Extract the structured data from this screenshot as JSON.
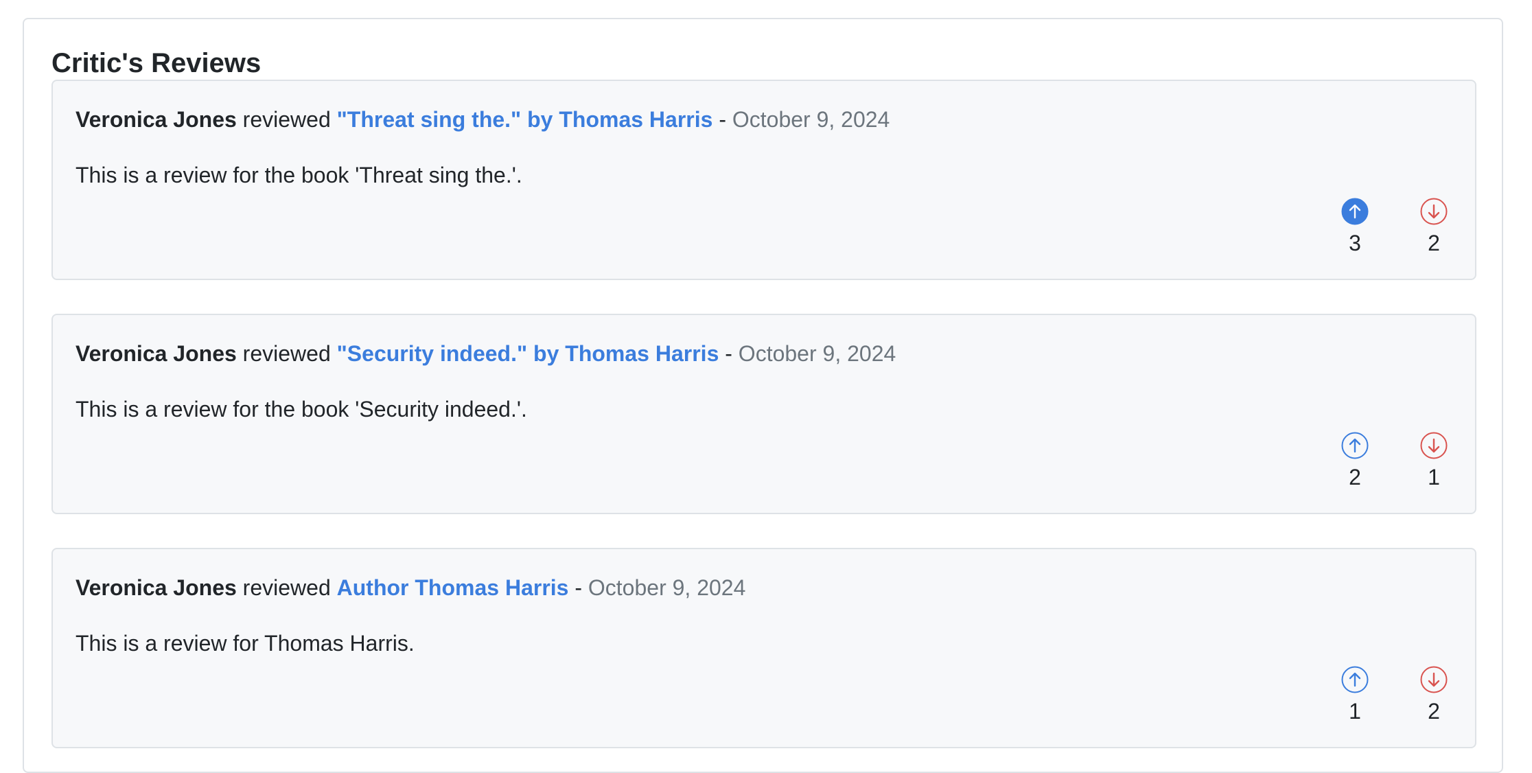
{
  "panel": {
    "title": "Critic's Reviews"
  },
  "reviews": [
    {
      "reviewer": "Veronica Jones",
      "verb": "reviewed",
      "target": "\"Threat sing the.\" by Thomas Harris",
      "separator": "-",
      "date": "October 9, 2024",
      "body": "This is a review for the book 'Threat sing the.'.",
      "upvotes": "3",
      "downvotes": "2",
      "upvote_active": true
    },
    {
      "reviewer": "Veronica Jones",
      "verb": "reviewed",
      "target": "\"Security indeed.\" by Thomas Harris",
      "separator": "-",
      "date": "October 9, 2024",
      "body": "This is a review for the book 'Security indeed.'.",
      "upvotes": "2",
      "downvotes": "1",
      "upvote_active": false
    },
    {
      "reviewer": "Veronica Jones",
      "verb": "reviewed",
      "target": "Author Thomas Harris",
      "separator": "-",
      "date": "October 9, 2024",
      "body": "This is a review for Thomas Harris.",
      "upvotes": "1",
      "downvotes": "2",
      "upvote_active": false
    }
  ],
  "icons": {
    "upvote": "arrow-up-circle-icon",
    "downvote": "arrow-down-circle-icon"
  },
  "colors": {
    "link": "#3b7ddd",
    "upvote": "#3b7ddd",
    "downvote": "#d9534f",
    "date": "#6c757d",
    "card_bg": "#f7f8fa",
    "border": "#dee2e6"
  }
}
